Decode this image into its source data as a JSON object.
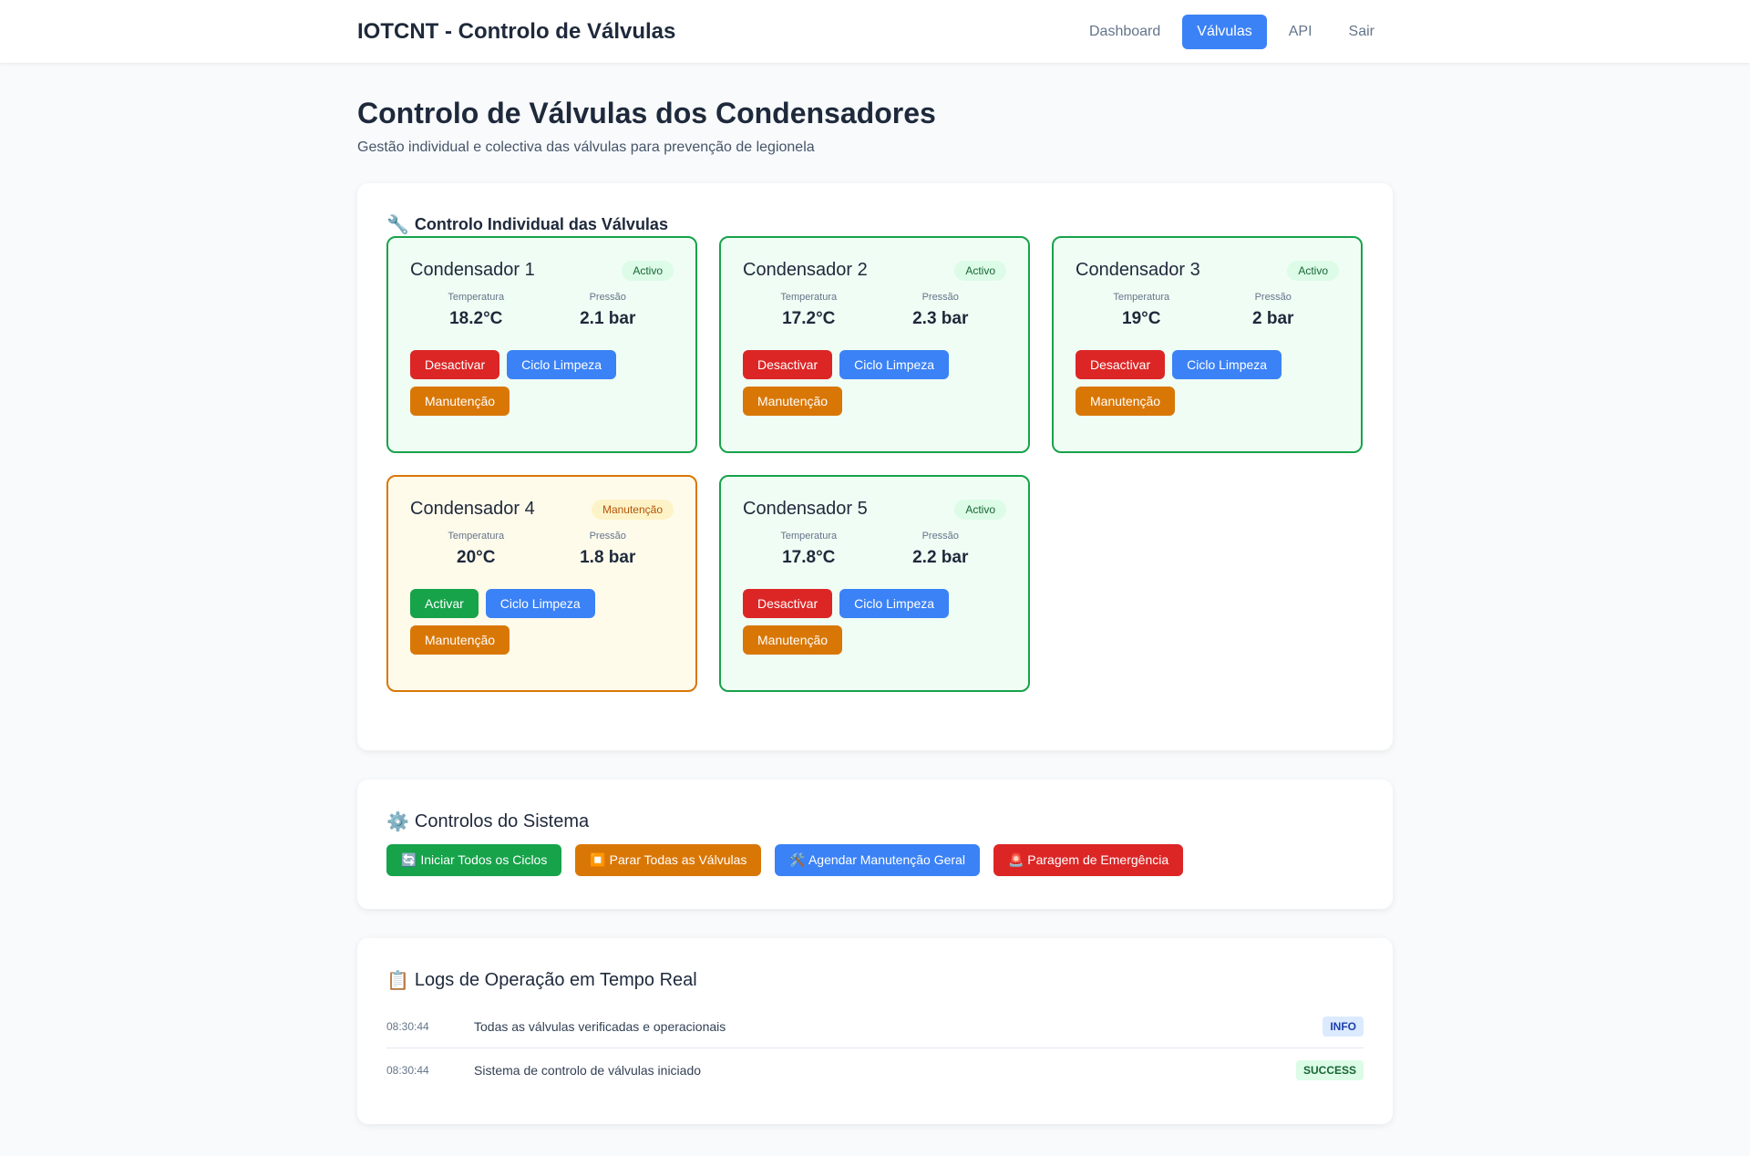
{
  "header": {
    "brand": "IOTCNT - Controlo de Válvulas",
    "nav": [
      {
        "label": "Dashboard",
        "active": false
      },
      {
        "label": "Válvulas",
        "active": true
      },
      {
        "label": "API",
        "active": false
      },
      {
        "label": "Sair",
        "active": false
      }
    ]
  },
  "page": {
    "title": "Controlo de Válvulas dos Condensadores",
    "subtitle": "Gestão individual e colectiva das válvulas para prevenção de legionela"
  },
  "valves_section": {
    "icon": "wrench-icon",
    "icon_glyph": "🔧",
    "title": "Controlo Individual das Válvulas",
    "cards": [
      {
        "name": "Condensador 1",
        "status": "Activo",
        "temp_label": "Temperatura",
        "temp": "18.2°C",
        "press_label": "Pressão",
        "press": "2.1 bar",
        "toggle_label": "Desactivar",
        "cycle_label": "Ciclo Limpeza",
        "maint_label": "Manutenção"
      },
      {
        "name": "Condensador 2",
        "status": "Activo",
        "temp_label": "Temperatura",
        "temp": "17.2°C",
        "press_label": "Pressão",
        "press": "2.3 bar",
        "toggle_label": "Desactivar",
        "cycle_label": "Ciclo Limpeza",
        "maint_label": "Manutenção"
      },
      {
        "name": "Condensador 3",
        "status": "Activo",
        "temp_label": "Temperatura",
        "temp": "19°C",
        "press_label": "Pressão",
        "press": "2 bar",
        "toggle_label": "Desactivar",
        "cycle_label": "Ciclo Limpeza",
        "maint_label": "Manutenção"
      },
      {
        "name": "Condensador 4",
        "status": "Manutenção",
        "temp_label": "Temperatura",
        "temp": "20°C",
        "press_label": "Pressão",
        "press": "1.8 bar",
        "toggle_label": "Activar",
        "cycle_label": "Ciclo Limpeza",
        "maint_label": "Manutenção"
      },
      {
        "name": "Condensador 5",
        "status": "Activo",
        "temp_label": "Temperatura",
        "temp": "17.8°C",
        "press_label": "Pressão",
        "press": "2.2 bar",
        "toggle_label": "Desactivar",
        "cycle_label": "Ciclo Limpeza",
        "maint_label": "Manutenção"
      }
    ]
  },
  "system_section": {
    "icon": "gear-icon",
    "icon_glyph": "⚙️",
    "title": "Controlos do Sistema",
    "buttons": {
      "start_all": "🔄 Iniciar Todos os Ciclos",
      "stop_all": "⏹️ Parar Todas as Válvulas",
      "schedule_maint": "🛠️ Agendar Manutenção Geral",
      "emergency": "🚨 Paragem de Emergência"
    }
  },
  "logs_section": {
    "icon": "clipboard-icon",
    "icon_glyph": "📋",
    "title": "Logs de Operação em Tempo Real",
    "entries": [
      {
        "time": "08:30:44",
        "message": "Todas as válvulas verificadas e operacionais",
        "level": "INFO"
      },
      {
        "time": "08:30:44",
        "message": "Sistema de controlo de válvulas iniciado",
        "level": "SUCCESS"
      }
    ]
  },
  "colors": {
    "accent_blue": "#3b82f6",
    "active_green": "#16a34a",
    "maintenance_orange": "#d97706",
    "danger_red": "#dc2626"
  }
}
